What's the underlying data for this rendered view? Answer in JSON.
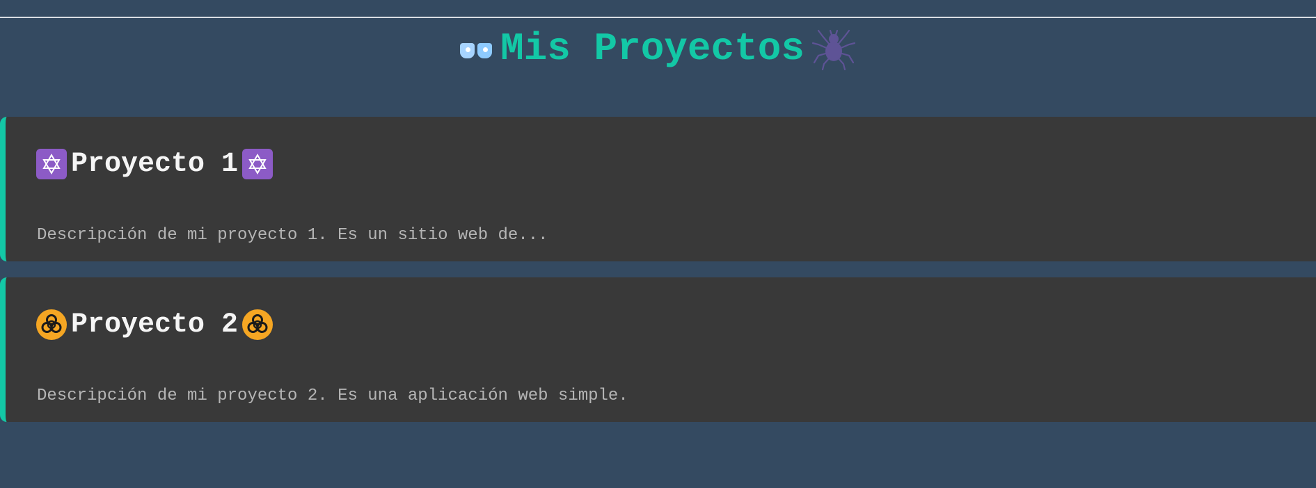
{
  "header": {
    "title": "Mis Proyectos",
    "left_icon": "eyes-icon",
    "right_icon": "spider-icon"
  },
  "projects": [
    {
      "title": "Proyecto 1",
      "description": "Descripción de mi proyecto 1. Es un sitio web de...",
      "icon": "six-pointed-star-icon",
      "icon_color": "#8c5bc6"
    },
    {
      "title": "Proyecto 2",
      "description": "Descripción de mi proyecto 2. Es una aplicación web simple.",
      "icon": "biohazard-icon",
      "icon_color": "#f5a623"
    }
  ],
  "colors": {
    "background": "#344a61",
    "accent": "#13c8a6",
    "card": "#393939",
    "spider": "#5e5396"
  }
}
